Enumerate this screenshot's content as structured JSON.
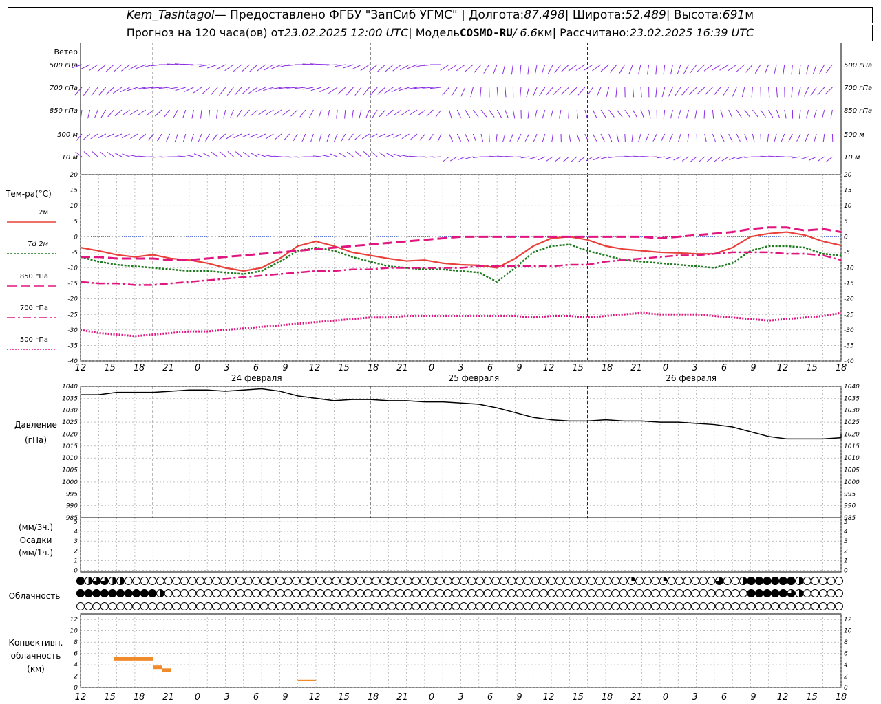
{
  "header": {
    "station": "Kem_Tashtagol",
    "provider": " — Предоставлено ФГБУ \"ЗапСиб УГМС\" | Долгота: ",
    "lon": "87.498",
    "lat_label": " | Широта: ",
    "lat": "52.489",
    "alt_label": " | Высота: ",
    "alt": "691",
    "alt_unit": "м",
    "forecast_label": "Прогноз на 120 часа(ов) от ",
    "forecast_from": "23.02.2025 12:00 UTC",
    "model_label": "  | Модель ",
    "model": "COSMO-RU",
    "model_res": " / 6.6",
    "model_res_unit": "км",
    "computed_label": " | Рассчитано: ",
    "computed": "23.02.2025 16:39 UTC"
  },
  "colors": {
    "wind": "#8a2be2",
    "t2m": "#e8403a",
    "td2m": "#1e7a1e",
    "t850": "#e0157f",
    "t700": "#e0157f",
    "t500": "#e0157f",
    "pressure": "#000000",
    "conv": "#f08a2a",
    "grid": "#999999"
  },
  "wind_panel": {
    "title": "Ветер",
    "levels": [
      "500 гПа",
      "700 гПа",
      "850 гПа",
      "500 м",
      "10 м"
    ]
  },
  "temp_panel": {
    "title": "Тем-ра(°C)",
    "legend": [
      {
        "label": "2м",
        "key": "t2m"
      },
      {
        "label": "Td  2м",
        "key": "td2m"
      },
      {
        "label": "850 гПа",
        "key": "t850"
      },
      {
        "label": "700 гПа",
        "key": "t700"
      },
      {
        "label": "500 гПа",
        "key": "t500"
      }
    ]
  },
  "pressure_panel": {
    "title": "Давление",
    "unit": "(гПа)"
  },
  "precip_panel": {
    "unit3": "(мм/3ч.)",
    "title": "Осадки",
    "unit1": "(мм/1ч.)"
  },
  "cloud_panel": {
    "title": "Облачность"
  },
  "conv_panel": {
    "title1": "Конвективн.",
    "title2": "облачность",
    "unit": "(км)"
  },
  "time_axis": {
    "hour_labels": [
      "12",
      "15",
      "18",
      "21",
      "0",
      "3",
      "6",
      "9",
      "12",
      "15",
      "18",
      "21",
      "0",
      "3",
      "6",
      "9",
      "12",
      "15",
      "18",
      "21",
      "0",
      "3",
      "6",
      "9",
      "12",
      "15",
      "18"
    ],
    "day_labels": [
      "24 февраля",
      "25 февраля",
      "26 февраля"
    ]
  },
  "chart_data": [
    {
      "type": "line",
      "name": "temperature",
      "x_hours": [
        0,
        3,
        6,
        9,
        12,
        15,
        18,
        21,
        24,
        27,
        30,
        33,
        36,
        39,
        42,
        45,
        48,
        51,
        54,
        57,
        60,
        63,
        66,
        69,
        72,
        75,
        78,
        81,
        84,
        87,
        90,
        93,
        96,
        99,
        102,
        105,
        108,
        111,
        114,
        117,
        120,
        123,
        126
      ],
      "ylim": [
        -40,
        20
      ],
      "yticks": [
        20,
        15,
        10,
        5,
        0,
        -5,
        -10,
        -15,
        -20,
        -25,
        -30,
        -35,
        -40
      ],
      "series": [
        {
          "name": "2м",
          "key": "t2m",
          "values": [
            -3.5,
            -4.5,
            -5.8,
            -6.5,
            -5.8,
            -7,
            -7.5,
            -8.5,
            -10,
            -11,
            -10,
            -7,
            -3,
            -1.5,
            -3,
            -5,
            -6,
            -7,
            -7.8,
            -7.5,
            -8.5,
            -9,
            -9.2,
            -10,
            -7,
            -3,
            -0.5,
            0,
            -1,
            -3,
            -4,
            -4.5,
            -5,
            -5.2,
            -5.5,
            -5.5,
            -3.5,
            0,
            1,
            1.5,
            0.5,
            -1.5,
            -2.8
          ]
        },
        {
          "name": "Td  2м",
          "key": "td2m",
          "values": [
            -6.5,
            -8,
            -9,
            -9.5,
            -10,
            -10.5,
            -11,
            -11,
            -11.5,
            -12,
            -11,
            -8,
            -4.5,
            -3.5,
            -4.5,
            -6.5,
            -8,
            -9.5,
            -10,
            -10.5,
            -10.5,
            -11,
            -11.5,
            -14.5,
            -10,
            -5,
            -3,
            -2.5,
            -4.5,
            -6,
            -7.5,
            -8,
            -8.5,
            -9,
            -9.5,
            -10,
            -8.5,
            -4.5,
            -3,
            -3,
            -3.5,
            -5.5,
            -6
          ]
        },
        {
          "name": "850 гПа",
          "key": "t850",
          "values": [
            -6.5,
            -6.5,
            -7,
            -7,
            -7,
            -7.5,
            -7.5,
            -7,
            -6.5,
            -6,
            -5.5,
            -5,
            -4.5,
            -4,
            -3.5,
            -3,
            -2.5,
            -2,
            -1.5,
            -1,
            -0.5,
            0,
            0,
            0,
            0,
            0,
            0,
            0,
            0,
            0,
            0,
            0,
            -0.5,
            0,
            0.5,
            1,
            1.5,
            2.5,
            3,
            3,
            2,
            2.5,
            1.5
          ]
        },
        {
          "name": "700 гПа",
          "key": "t700",
          "values": [
            -14.5,
            -15,
            -15,
            -15.5,
            -15.5,
            -15,
            -14.5,
            -14,
            -13.5,
            -13,
            -12.5,
            -12,
            -11.5,
            -11,
            -11,
            -10.5,
            -10.5,
            -10,
            -10,
            -10,
            -10,
            -10,
            -9.5,
            -9.5,
            -9.5,
            -9.5,
            -9.5,
            -9,
            -9,
            -8,
            -7.5,
            -7,
            -6.5,
            -6,
            -6,
            -5.5,
            -5,
            -5,
            -5,
            -5.5,
            -5.5,
            -6,
            -7.5
          ]
        },
        {
          "name": "500 гПа",
          "key": "t500",
          "values": [
            -30,
            -31,
            -31.5,
            -32,
            -31.5,
            -31,
            -30.5,
            -30.5,
            -30,
            -29.5,
            -29,
            -28.5,
            -28,
            -27.5,
            -27,
            -26.5,
            -26,
            -26,
            -25.5,
            -25.5,
            -25.5,
            -25.5,
            -25.5,
            -25.5,
            -25.5,
            -26,
            -25.5,
            -25.5,
            -26,
            -25.5,
            -25,
            -24.5,
            -25,
            -25,
            -25,
            -25.5,
            -26,
            -26.5,
            -27,
            -26.5,
            -26,
            -25.5,
            -24.5
          ]
        }
      ]
    },
    {
      "type": "line",
      "name": "pressure",
      "x_hours": [
        0,
        3,
        6,
        9,
        12,
        15,
        18,
        21,
        24,
        27,
        30,
        33,
        36,
        39,
        42,
        45,
        48,
        51,
        54,
        57,
        60,
        63,
        66,
        69,
        72,
        75,
        78,
        81,
        84,
        87,
        90,
        93,
        96,
        99,
        102,
        105,
        108,
        111,
        114,
        117,
        120,
        123,
        126
      ],
      "ylim": [
        985,
        1040
      ],
      "yticks": [
        1040,
        1035,
        1030,
        1025,
        1020,
        1015,
        1010,
        1005,
        1000,
        995,
        990,
        985
      ],
      "series": [
        {
          "name": "Давление",
          "key": "pressure",
          "values": [
            1036.5,
            1036.5,
            1037.5,
            1037.5,
            1037.5,
            1038,
            1038.5,
            1038.5,
            1038,
            1038.5,
            1039,
            1038,
            1036,
            1035,
            1034,
            1034.5,
            1034.5,
            1034,
            1034,
            1033.5,
            1033.5,
            1033,
            1032.5,
            1031,
            1029,
            1027,
            1026,
            1025.5,
            1025.5,
            1026,
            1025.5,
            1025.5,
            1025,
            1025,
            1024.5,
            1024,
            1023,
            1021,
            1019,
            1018,
            1018,
            1018,
            1018.5,
            1020
          ]
        }
      ]
    },
    {
      "type": "bar",
      "name": "precipitation",
      "ylim": [
        0,
        5
      ],
      "yticks": [
        5,
        4,
        3,
        2,
        1,
        0
      ],
      "values": []
    },
    {
      "type": "bar",
      "name": "convective_cloud",
      "ylim": [
        0,
        12
      ],
      "yticks": [
        12,
        10,
        8,
        6,
        4,
        2,
        0
      ],
      "segments": [
        {
          "from_h": 5.5,
          "to_h": 12,
          "base": 5,
          "top": 5
        },
        {
          "from_h": 12,
          "to_h": 13.5,
          "base": 3.5,
          "top": 3.5
        },
        {
          "from_h": 13.5,
          "to_h": 15,
          "base": 3,
          "top": 3
        },
        {
          "from_h": 36,
          "to_h": 39,
          "base": 1,
          "top": 1
        }
      ]
    }
  ],
  "cloud_rows": {
    "upper": [
      4,
      2,
      3,
      3,
      2,
      2,
      0,
      0,
      0,
      0,
      0,
      0,
      0,
      0,
      0,
      0,
      0,
      0,
      0,
      0,
      0,
      0,
      0,
      0,
      0,
      0,
      0,
      0,
      0,
      0,
      0,
      0,
      0,
      0,
      0,
      0,
      0,
      0,
      0,
      0,
      0,
      0,
      0,
      0,
      0,
      0,
      0,
      0,
      0,
      0,
      0,
      0,
      0,
      0,
      0,
      0,
      0,
      0,
      0,
      0,
      0,
      0,
      0,
      0,
      0,
      0,
      0,
      0,
      0,
      1,
      0,
      0,
      0,
      1,
      0,
      0,
      0,
      0,
      0,
      0,
      3,
      0,
      0,
      2,
      4,
      4,
      4,
      4,
      4,
      4,
      2,
      0,
      0,
      0,
      0,
      0,
      0,
      0
    ],
    "middle": [
      4,
      4,
      4,
      4,
      4,
      4,
      4,
      4,
      4,
      4,
      2,
      0,
      0,
      0,
      0,
      0,
      0,
      0,
      0,
      0,
      0,
      0,
      0,
      0,
      0,
      0,
      0,
      0,
      0,
      0,
      0,
      0,
      0,
      0,
      0,
      0,
      0,
      0,
      0,
      0,
      0,
      0,
      0,
      0,
      0,
      0,
      0,
      0,
      0,
      0,
      0,
      0,
      0,
      0,
      0,
      0,
      0,
      0,
      0,
      0,
      0,
      0,
      0,
      0,
      0,
      0,
      0,
      0,
      0,
      0,
      0,
      0,
      0,
      0,
      0,
      0,
      0,
      0,
      0,
      0,
      0,
      0,
      0,
      0,
      4,
      4,
      4,
      4,
      4,
      3,
      2,
      0,
      0,
      0,
      0,
      0,
      0,
      0
    ],
    "lower": [
      0,
      0,
      0,
      0,
      0,
      0,
      0,
      0,
      0,
      0,
      0,
      0,
      0,
      0,
      0,
      0,
      0,
      0,
      0,
      0,
      0,
      0,
      0,
      0,
      0,
      0,
      0,
      0,
      0,
      0,
      0,
      0,
      0,
      0,
      0,
      0,
      0,
      0,
      0,
      0,
      0,
      0,
      0,
      0,
      0,
      0,
      0,
      0,
      0,
      0,
      0,
      0,
      0,
      0,
      0,
      0,
      0,
      0,
      0,
      0,
      0,
      0,
      0,
      0,
      0,
      0,
      0,
      0,
      0,
      0,
      0,
      0,
      0,
      0,
      0,
      0,
      0,
      0,
      0,
      0,
      0,
      0,
      0,
      0,
      0,
      0,
      0,
      0,
      0,
      0,
      0,
      0,
      0,
      0,
      0,
      0,
      0,
      0
    ]
  }
}
